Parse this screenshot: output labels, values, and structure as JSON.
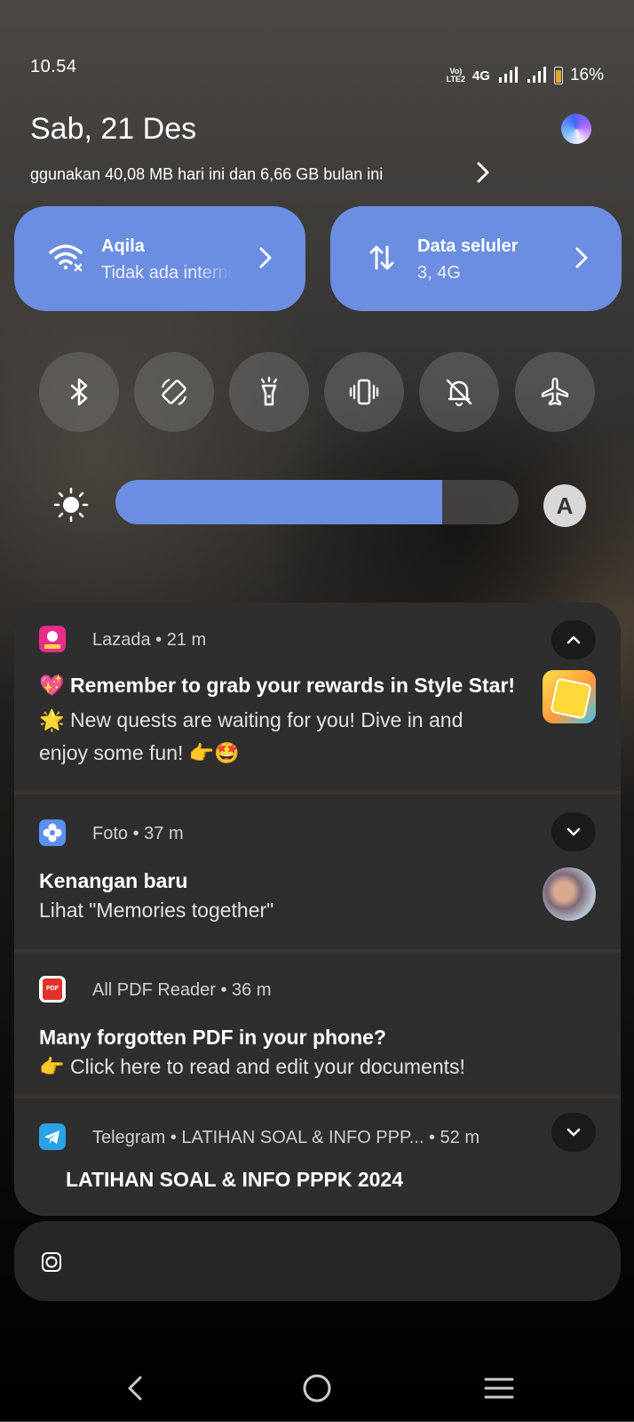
{
  "status_bar": {
    "time": "10.54",
    "volte": "Vo)) LTE2",
    "network_type": "4G",
    "battery_percent": "16%",
    "battery_level": 0.16
  },
  "header": {
    "date": "Sab, 21 Des",
    "data_usage": "ggunakan 40,08 MB hari ini dan 6,66 GB bulan ini"
  },
  "quick_tiles": {
    "wifi": {
      "title": "Aqila",
      "subtitle": "Tidak ada internet",
      "icon": "wifi-off-icon"
    },
    "mobile_data": {
      "title": "Data seluler",
      "subtitle": "3, 4G",
      "icon": "data-arrows-icon"
    },
    "toggles": [
      "bluetooth-icon",
      "auto-rotate-icon",
      "flashlight-icon",
      "vibrate-icon",
      "mute-icon",
      "airplane-mode-icon"
    ]
  },
  "brightness": {
    "level": 0.81,
    "auto_label": "A"
  },
  "notifications": [
    {
      "app": "Lazada • 21 m",
      "title": "💖 Remember to grab your rewards in Style Star!",
      "body_line1": "🌟 New quests are waiting for you! Dive in and",
      "body_line2": "enjoy some fun! 👉🤩",
      "expanded": true,
      "icon_color": "#e82e8a"
    },
    {
      "app": "Foto • 37 m",
      "title": "Kenangan baru",
      "body": "Lihat \"Memories together\"",
      "expanded": false,
      "icon_color": "#5b8ff0"
    },
    {
      "app": "All PDF Reader • 36 m",
      "title": "Many forgotten PDF in your phone?",
      "body": "👉 Click here to read and edit your documents!",
      "icon_label": "PDF",
      "icon_color": "#e0322a"
    },
    {
      "app": "Telegram • LATIHAN SOAL & INFO PPP... • 52 m",
      "title": "LATIHAN SOAL & INFO PPPK 2024",
      "expanded": false,
      "icon_color": "#2aa3e6"
    }
  ],
  "colors": {
    "accent": "#6b8ee0",
    "panel": "#2e2e2f"
  }
}
